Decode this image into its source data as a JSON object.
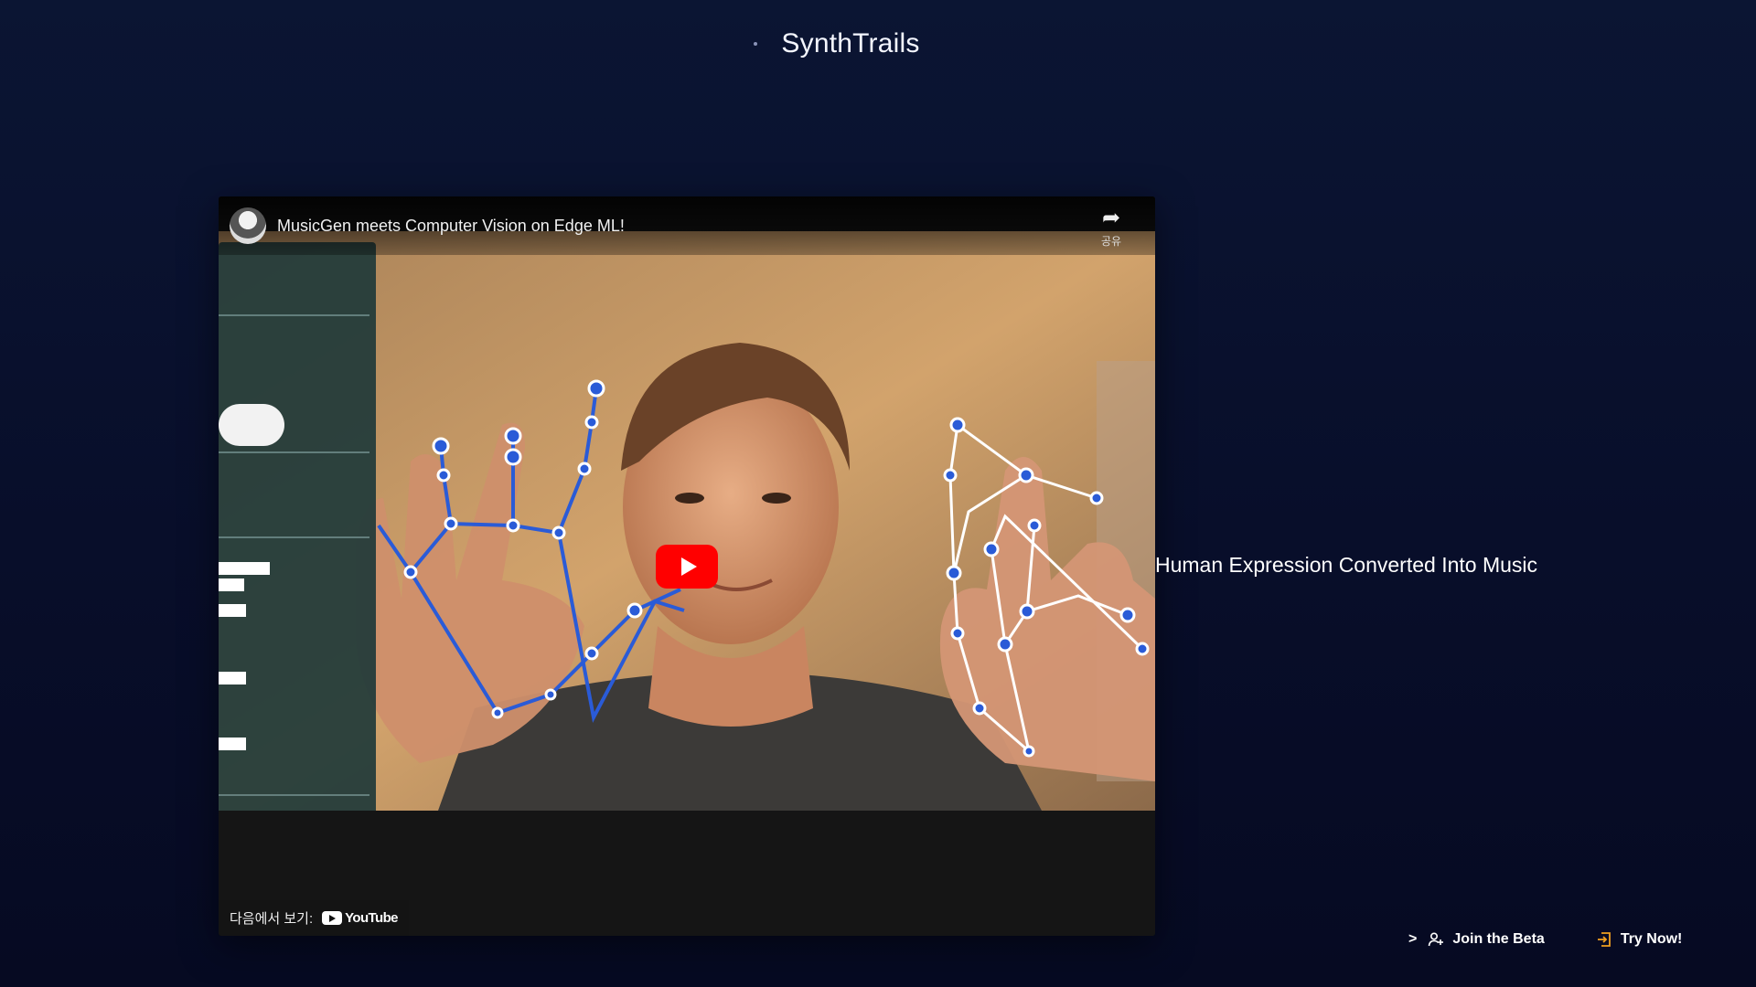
{
  "brand": {
    "name": "SynthTrails"
  },
  "video": {
    "title": "MusicGen meets Computer Vision on Edge ML!",
    "share_label": "공유",
    "share_icon": "share-arrow-icon",
    "watch_on_label": "다음에서 보기:",
    "platform": "YouTube",
    "play_icon": "play-icon"
  },
  "tagline": "Human Expression Converted Into Music",
  "actions": {
    "join_caret": ">",
    "join_label": "Join the Beta",
    "join_icon": "user-plus-icon",
    "try_label": "Try Now!",
    "try_icon": "login-icon"
  },
  "colors": {
    "background": "#0a1230",
    "youtube_red": "#ff0000",
    "landmark_blue": "#2a5bd7",
    "try_icon_color": "#f0a020"
  }
}
